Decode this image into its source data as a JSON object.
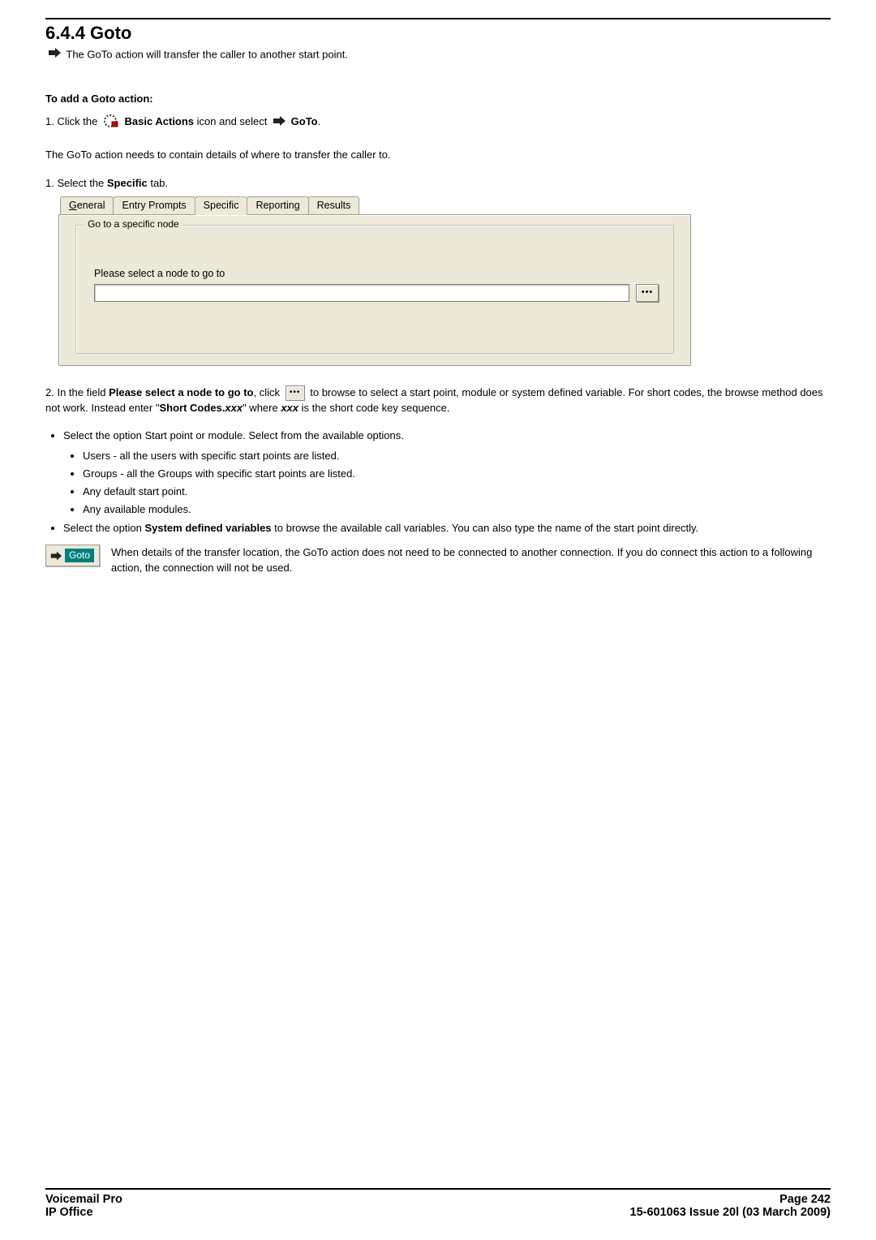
{
  "section_number": "6.4.4 Goto",
  "intro": "The GoTo action will transfer the caller to another start point.",
  "add_heading": "To add a Goto action:",
  "step1_prefix": "1. Click the ",
  "step1_bold1": "Basic Actions",
  "step1_mid": " icon and select ",
  "step1_bold2": "GoTo",
  "step1_suffix": ".",
  "needs_details": "The GoTo action needs to contain details of where to transfer the caller to.",
  "select_specific_prefix": "1. Select the ",
  "select_specific_bold": "Specific",
  "select_specific_suffix": " tab.",
  "tabs": {
    "general": "General",
    "entry": "Entry Prompts",
    "specific": "Specific",
    "reporting": "Reporting",
    "results": "Results"
  },
  "groupbox_title": "Go to a specific node",
  "field_label": "Please select a node to go to",
  "node_value": "",
  "browse_glyph": "•••",
  "step2_prefix": "2. In the field ",
  "step2_field": "Please select a node to go to",
  "step2_mid1": ", click ",
  "step2_mid2": " to browse to select a start point, module or system defined variable. For short codes, the browse method does not work. Instead enter \"",
  "step2_shortcodes": "Short Codes.",
  "step2_xxx": "xxx",
  "step2_mid3": "\" where ",
  "step2_suffix": " is the short code key sequence.",
  "bullets": {
    "b1": "Select the option Start point or module. Select from the available options.",
    "b1a": "Users - all the users with specific start points are listed.",
    "b1b": "Groups - all the Groups with specific start points are listed.",
    "b1c": "Any default start point.",
    "b1d": "Any available modules.",
    "b2_pre": "Select the option ",
    "b2_bold": "System defined variables",
    "b2_post": " to browse the available call variables. You can also type the name of the start point directly."
  },
  "goto_label": "Goto",
  "note": "When details of the transfer location, the GoTo action does not need to be connected to another connection. If you do connect this action to a following action, the connection will not be used.",
  "footer": {
    "left1": "Voicemail Pro",
    "left2": "IP Office",
    "right1": "Page 242",
    "right2": "15-601063 Issue 20l (03 March 2009)"
  }
}
